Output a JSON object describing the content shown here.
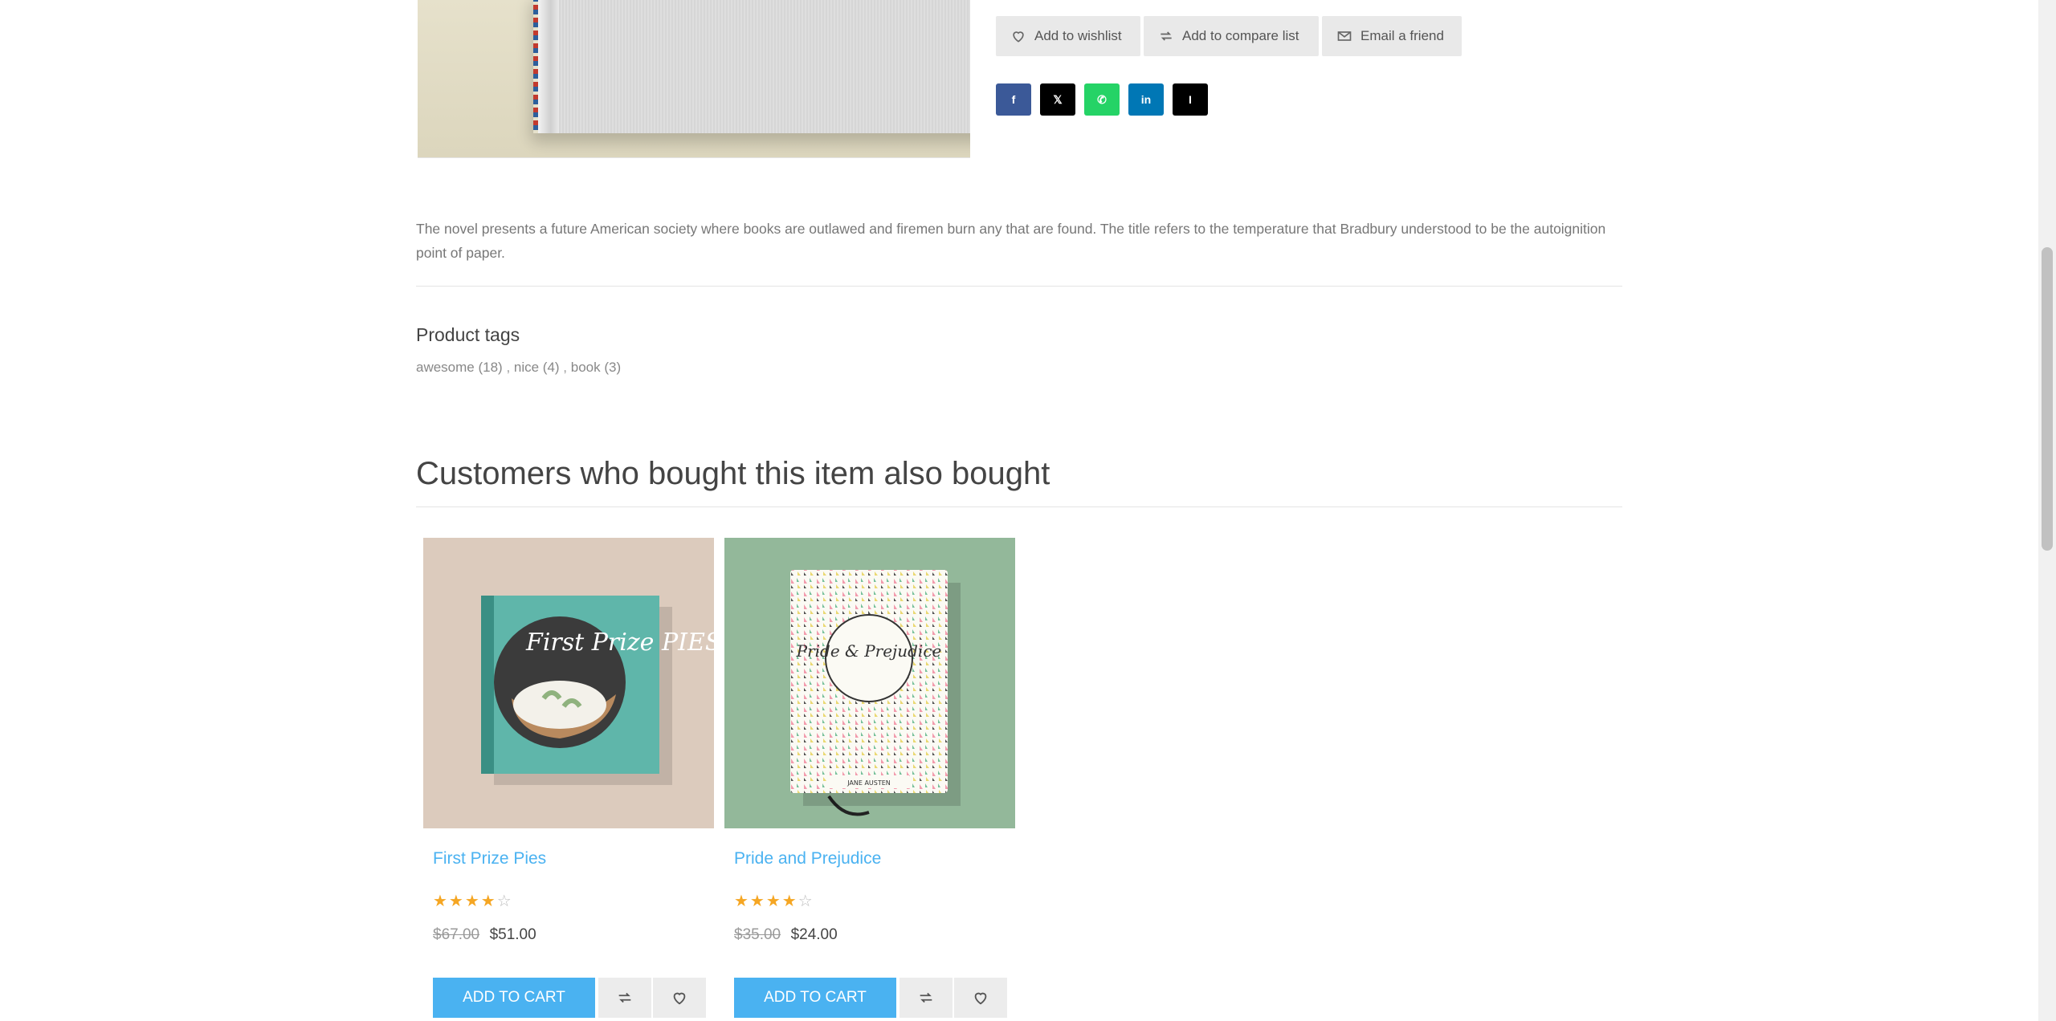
{
  "actions": {
    "wishlist": "Add to wishlist",
    "compare": "Add to compare list",
    "email": "Email a friend"
  },
  "share": [
    {
      "name": "facebook",
      "glyph": "f",
      "color": "#3b5998"
    },
    {
      "name": "x",
      "glyph": "𝕏",
      "color": "#000000"
    },
    {
      "name": "whatsapp",
      "glyph": "✆",
      "color": "#25d366"
    },
    {
      "name": "linkedin",
      "glyph": "in",
      "color": "#0077b5"
    },
    {
      "name": "instapaper",
      "glyph": "I",
      "color": "#000000"
    }
  ],
  "description": "The novel presents a future American society where books are outlawed and firemen burn any that are found. The title refers to the temperature that Bradbury understood to be the autoignition point of paper.",
  "tags": {
    "title": "Product tags",
    "items": [
      "awesome (18)",
      "nice (4)",
      "book (3)"
    ]
  },
  "related": {
    "title": "Customers who bought this item also bought",
    "products": [
      {
        "title": "First Prize Pies",
        "rating": 4,
        "old_price": "$67.00",
        "price": "$51.00",
        "cart": "Add to cart",
        "cover_text": "First Prize PIES"
      },
      {
        "title": "Pride and Prejudice",
        "rating": 4,
        "old_price": "$35.00",
        "price": "$24.00",
        "cart": "Add to cart",
        "cover_text": "Pride & Prejudice",
        "author_text": "JANE AUSTEN"
      }
    ]
  },
  "colors": {
    "accent": "#4ab2f1",
    "star": "#f5a623"
  }
}
